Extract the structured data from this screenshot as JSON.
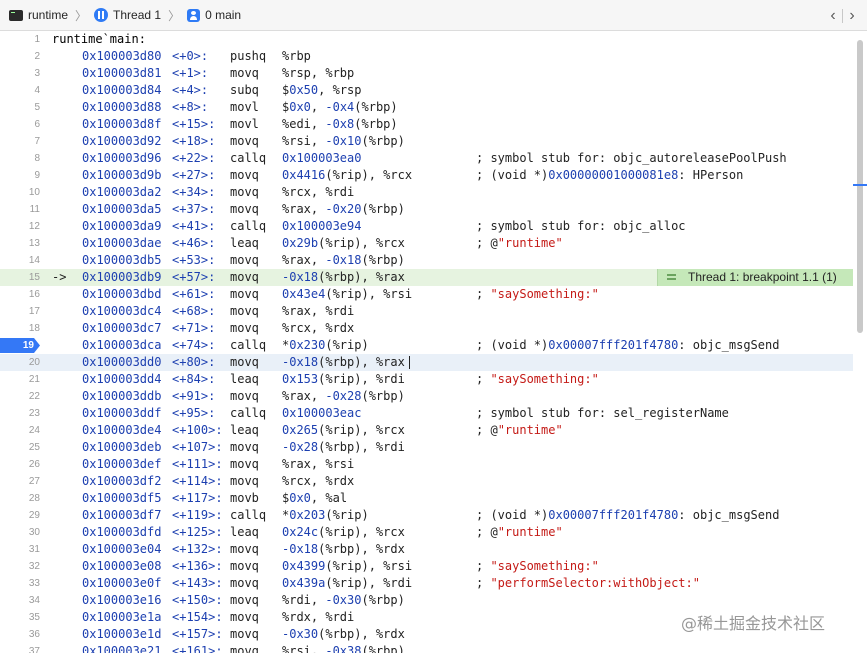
{
  "jumpbar": {
    "items": [
      {
        "label": "runtime",
        "icon": "terminal-icon"
      },
      {
        "label": "Thread 1",
        "icon": "thread-icon"
      },
      {
        "label": "0 main",
        "icon": "stack-frame-icon"
      }
    ],
    "separator": "〉",
    "back": "‹",
    "forward": "›"
  },
  "breakpoint_badge": "Thread 1: breakpoint 1.1 (1)",
  "pc_arrow": "->",
  "lines": [
    {
      "n": "1",
      "text": "runtime`main:"
    },
    {
      "n": "2",
      "addr": "0x100003d80",
      "off": "<+0>:",
      "mn": "pushq",
      "ops": [
        {
          "t": "%rbp"
        }
      ]
    },
    {
      "n": "3",
      "addr": "0x100003d81",
      "off": "<+1>:",
      "mn": "movq",
      "ops": [
        {
          "t": "%rsp, %rbp"
        }
      ]
    },
    {
      "n": "4",
      "addr": "0x100003d84",
      "off": "<+4>:",
      "mn": "subq",
      "ops": [
        {
          "t": "$"
        },
        {
          "t": "0x50",
          "k": "num"
        },
        {
          "t": ", %rsp"
        }
      ]
    },
    {
      "n": "5",
      "addr": "0x100003d88",
      "off": "<+8>:",
      "mn": "movl",
      "ops": [
        {
          "t": "$"
        },
        {
          "t": "0x0",
          "k": "num"
        },
        {
          "t": ", "
        },
        {
          "t": "-0x4",
          "k": "num"
        },
        {
          "t": "(%rbp)"
        }
      ]
    },
    {
      "n": "6",
      "addr": "0x100003d8f",
      "off": "<+15>:",
      "mn": "movl",
      "ops": [
        {
          "t": "%edi, "
        },
        {
          "t": "-0x8",
          "k": "num"
        },
        {
          "t": "(%rbp)"
        }
      ]
    },
    {
      "n": "7",
      "addr": "0x100003d92",
      "off": "<+18>:",
      "mn": "movq",
      "ops": [
        {
          "t": "%rsi, "
        },
        {
          "t": "-0x10",
          "k": "num"
        },
        {
          "t": "(%rbp)"
        }
      ]
    },
    {
      "n": "8",
      "addr": "0x100003d96",
      "off": "<+22>:",
      "mn": "callq",
      "ops": [
        {
          "t": "0x100003ea0",
          "k": "num"
        }
      ],
      "cmt": [
        {
          "t": "; symbol stub for: objc_autoreleasePoolPush"
        }
      ]
    },
    {
      "n": "9",
      "addr": "0x100003d9b",
      "off": "<+27>:",
      "mn": "movq",
      "ops": [
        {
          "t": "0x4416",
          "k": "num"
        },
        {
          "t": "(%rip), %rcx"
        }
      ],
      "cmt": [
        {
          "t": "; (void *)"
        },
        {
          "t": "0x00000001000081e8",
          "k": "num"
        },
        {
          "t": ": HPerson"
        }
      ]
    },
    {
      "n": "10",
      "addr": "0x100003da2",
      "off": "<+34>:",
      "mn": "movq",
      "ops": [
        {
          "t": "%rcx, %rdi"
        }
      ]
    },
    {
      "n": "11",
      "addr": "0x100003da5",
      "off": "<+37>:",
      "mn": "movq",
      "ops": [
        {
          "t": "%rax, "
        },
        {
          "t": "-0x20",
          "k": "num"
        },
        {
          "t": "(%rbp)"
        }
      ]
    },
    {
      "n": "12",
      "addr": "0x100003da9",
      "off": "<+41>:",
      "mn": "callq",
      "ops": [
        {
          "t": "0x100003e94",
          "k": "num"
        }
      ],
      "cmt": [
        {
          "t": "; symbol stub for: objc_alloc"
        }
      ]
    },
    {
      "n": "13",
      "addr": "0x100003dae",
      "off": "<+46>:",
      "mn": "leaq",
      "ops": [
        {
          "t": "0x29b",
          "k": "num"
        },
        {
          "t": "(%rip), %rcx"
        }
      ],
      "cmt": [
        {
          "t": "; @"
        },
        {
          "t": "\"runtime\"",
          "k": "str"
        }
      ]
    },
    {
      "n": "14",
      "addr": "0x100003db5",
      "off": "<+53>:",
      "mn": "movq",
      "ops": [
        {
          "t": "%rax, "
        },
        {
          "t": "-0x18",
          "k": "num"
        },
        {
          "t": "(%rbp)"
        }
      ]
    },
    {
      "n": "15",
      "addr": "0x100003db9",
      "off": "<+57>:",
      "mn": "movq",
      "ops": [
        {
          "t": "-0x18",
          "k": "num"
        },
        {
          "t": "(%rbp), %rax"
        }
      ],
      "pc": true
    },
    {
      "n": "16",
      "addr": "0x100003dbd",
      "off": "<+61>:",
      "mn": "movq",
      "ops": [
        {
          "t": "0x43e4",
          "k": "num"
        },
        {
          "t": "(%rip), %rsi"
        }
      ],
      "cmt": [
        {
          "t": "; "
        },
        {
          "t": "\"saySomething:\"",
          "k": "str"
        }
      ]
    },
    {
      "n": "17",
      "addr": "0x100003dc4",
      "off": "<+68>:",
      "mn": "movq",
      "ops": [
        {
          "t": "%rax, %rdi"
        }
      ]
    },
    {
      "n": "18",
      "addr": "0x100003dc7",
      "off": "<+71>:",
      "mn": "movq",
      "ops": [
        {
          "t": "%rcx, %rdx"
        }
      ]
    },
    {
      "n": "19",
      "addr": "0x100003dca",
      "off": "<+74>:",
      "mn": "callq",
      "ops": [
        {
          "t": "*"
        },
        {
          "t": "0x230",
          "k": "num"
        },
        {
          "t": "(%rip)"
        }
      ],
      "cmt": [
        {
          "t": "; (void *)"
        },
        {
          "t": "0x00007fff201f4780",
          "k": "num"
        },
        {
          "t": ": objc_msgSend"
        }
      ],
      "bp": true
    },
    {
      "n": "20",
      "addr": "0x100003dd0",
      "off": "<+80>:",
      "mn": "movq",
      "ops": [
        {
          "t": "-0x18",
          "k": "num"
        },
        {
          "t": "(%rbp), %rax"
        }
      ],
      "cur": true
    },
    {
      "n": "21",
      "addr": "0x100003dd4",
      "off": "<+84>:",
      "mn": "leaq",
      "ops": [
        {
          "t": "0x153",
          "k": "num"
        },
        {
          "t": "(%rip), %rdi"
        }
      ],
      "cmt": [
        {
          "t": "; "
        },
        {
          "t": "\"saySomething:\"",
          "k": "str"
        }
      ]
    },
    {
      "n": "22",
      "addr": "0x100003ddb",
      "off": "<+91>:",
      "mn": "movq",
      "ops": [
        {
          "t": "%rax, "
        },
        {
          "t": "-0x28",
          "k": "num"
        },
        {
          "t": "(%rbp)"
        }
      ]
    },
    {
      "n": "23",
      "addr": "0x100003ddf",
      "off": "<+95>:",
      "mn": "callq",
      "ops": [
        {
          "t": "0x100003eac",
          "k": "num"
        }
      ],
      "cmt": [
        {
          "t": "; symbol stub for: sel_registerName"
        }
      ]
    },
    {
      "n": "24",
      "addr": "0x100003de4",
      "off": "<+100>:",
      "mn": "leaq",
      "ops": [
        {
          "t": "0x265",
          "k": "num"
        },
        {
          "t": "(%rip), %rcx"
        }
      ],
      "cmt": [
        {
          "t": "; @"
        },
        {
          "t": "\"runtime\"",
          "k": "str"
        }
      ]
    },
    {
      "n": "25",
      "addr": "0x100003deb",
      "off": "<+107>:",
      "mn": "movq",
      "ops": [
        {
          "t": "-0x28",
          "k": "num"
        },
        {
          "t": "(%rbp), %rdi"
        }
      ]
    },
    {
      "n": "26",
      "addr": "0x100003def",
      "off": "<+111>:",
      "mn": "movq",
      "ops": [
        {
          "t": "%rax, %rsi"
        }
      ]
    },
    {
      "n": "27",
      "addr": "0x100003df2",
      "off": "<+114>:",
      "mn": "movq",
      "ops": [
        {
          "t": "%rcx, %rdx"
        }
      ]
    },
    {
      "n": "28",
      "addr": "0x100003df5",
      "off": "<+117>:",
      "mn": "movb",
      "ops": [
        {
          "t": "$"
        },
        {
          "t": "0x0",
          "k": "num"
        },
        {
          "t": ", %al"
        }
      ]
    },
    {
      "n": "29",
      "addr": "0x100003df7",
      "off": "<+119>:",
      "mn": "callq",
      "ops": [
        {
          "t": "*"
        },
        {
          "t": "0x203",
          "k": "num"
        },
        {
          "t": "(%rip)"
        }
      ],
      "cmt": [
        {
          "t": "; (void *)"
        },
        {
          "t": "0x00007fff201f4780",
          "k": "num"
        },
        {
          "t": ": objc_msgSend"
        }
      ]
    },
    {
      "n": "30",
      "addr": "0x100003dfd",
      "off": "<+125>:",
      "mn": "leaq",
      "ops": [
        {
          "t": "0x24c",
          "k": "num"
        },
        {
          "t": "(%rip), %rcx"
        }
      ],
      "cmt": [
        {
          "t": "; @"
        },
        {
          "t": "\"runtime\"",
          "k": "str"
        }
      ]
    },
    {
      "n": "31",
      "addr": "0x100003e04",
      "off": "<+132>:",
      "mn": "movq",
      "ops": [
        {
          "t": "-0x18",
          "k": "num"
        },
        {
          "t": "(%rbp), %rdx"
        }
      ]
    },
    {
      "n": "32",
      "addr": "0x100003e08",
      "off": "<+136>:",
      "mn": "movq",
      "ops": [
        {
          "t": "0x4399",
          "k": "num"
        },
        {
          "t": "(%rip), %rsi"
        }
      ],
      "cmt": [
        {
          "t": "; "
        },
        {
          "t": "\"saySomething:\"",
          "k": "str"
        }
      ]
    },
    {
      "n": "33",
      "addr": "0x100003e0f",
      "off": "<+143>:",
      "mn": "movq",
      "ops": [
        {
          "t": "0x439a",
          "k": "num"
        },
        {
          "t": "(%rip), %rdi"
        }
      ],
      "cmt": [
        {
          "t": "; "
        },
        {
          "t": "\"performSelector:withObject:\"",
          "k": "str"
        }
      ]
    },
    {
      "n": "34",
      "addr": "0x100003e16",
      "off": "<+150>:",
      "mn": "movq",
      "ops": [
        {
          "t": "%rdi, "
        },
        {
          "t": "-0x30",
          "k": "num"
        },
        {
          "t": "(%rbp)"
        }
      ]
    },
    {
      "n": "35",
      "addr": "0x100003e1a",
      "off": "<+154>:",
      "mn": "movq",
      "ops": [
        {
          "t": "%rdx, %rdi"
        }
      ]
    },
    {
      "n": "36",
      "addr": "0x100003e1d",
      "off": "<+157>:",
      "mn": "movq",
      "ops": [
        {
          "t": "-0x30",
          "k": "num"
        },
        {
          "t": "(%rbp), %rdx"
        }
      ]
    },
    {
      "n": "37",
      "addr": "0x100003e21",
      "off": "<+161>:",
      "mn": "movq",
      "ops": [
        {
          "t": "%rsi, "
        },
        {
          "t": "-0x38",
          "k": "num"
        },
        {
          "t": "(%rbp)"
        }
      ]
    }
  ],
  "watermark": "@稀土掘金技术社区",
  "colors": {
    "address": "#1c3fb0",
    "string": "#c41a16",
    "pc_line": "#e6f3e0",
    "current_line": "#e9f0f8",
    "breakpoint": "#3478f6",
    "badge": "#c5e8b9"
  }
}
